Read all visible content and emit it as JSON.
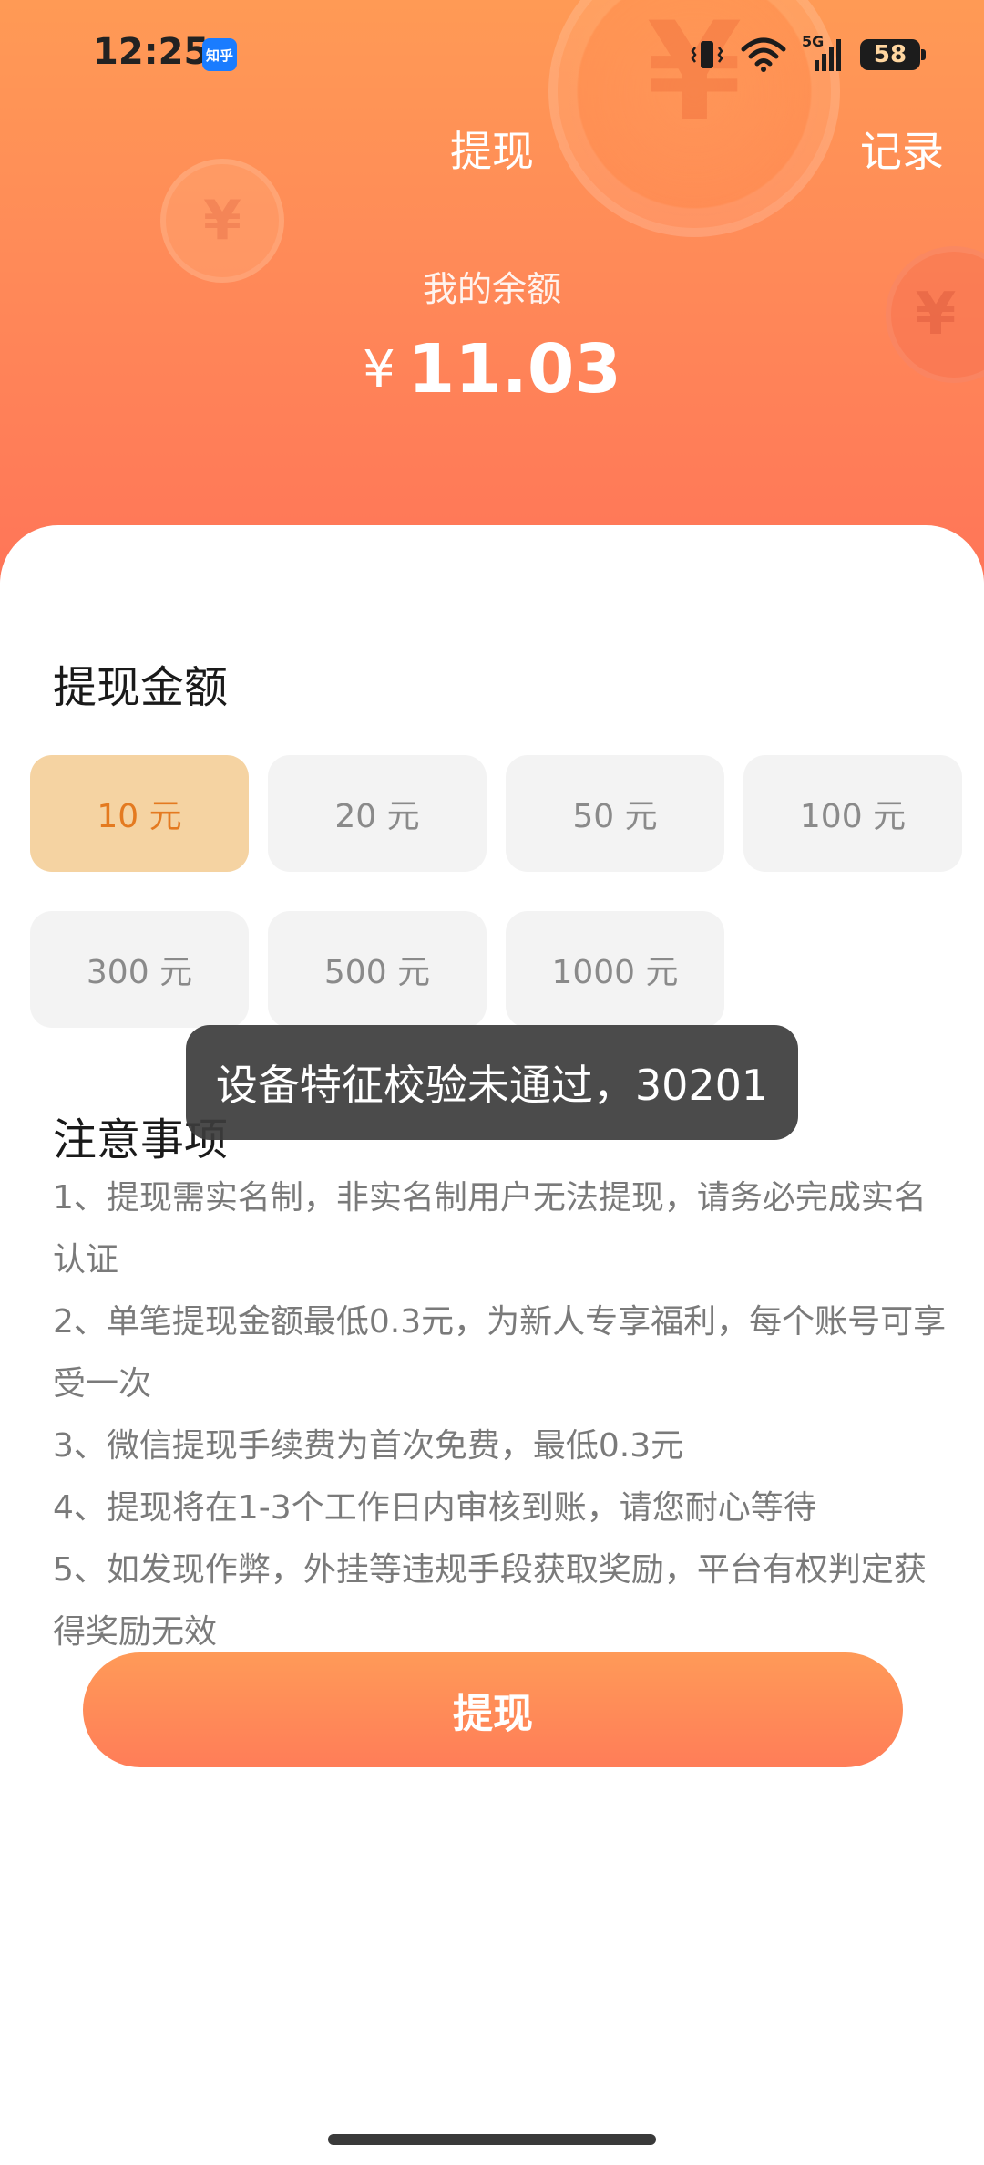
{
  "status_bar": {
    "time": "12:25",
    "app_badge": "知乎",
    "network_label": "5G",
    "battery": "58"
  },
  "nav": {
    "title": "提现",
    "record": "记录"
  },
  "balance": {
    "label": "我的余额",
    "currency": "¥",
    "amount": "11.03"
  },
  "amount_section": {
    "title": "提现金额",
    "options": [
      {
        "label": "10 元",
        "selected": true
      },
      {
        "label": "20 元",
        "selected": false
      },
      {
        "label": "50 元",
        "selected": false
      },
      {
        "label": "100 元",
        "selected": false
      },
      {
        "label": "300 元",
        "selected": false
      },
      {
        "label": "500 元",
        "selected": false
      },
      {
        "label": "1000 元",
        "selected": false
      }
    ]
  },
  "notice": {
    "title": "注意事项",
    "items": [
      "1、提现需实名制，非实名制用户无法提现，请务必完成实名认证",
      "2、单笔提现金额最低0.3元，为新人专享福利，每个账号可享受一次",
      "3、微信提现手续费为首次免费，最低0.3元",
      "4、提现将在1-3个工作日内审核到账，请您耐心等待",
      "5、如发现作弊，外挂等违规手段获取奖励，平台有权判定获得奖励无效"
    ]
  },
  "toast": "设备特征校验未通过，30201",
  "withdraw_button": "提现",
  "colors": {
    "header_top": "#ff9a55",
    "header_bottom": "#ff7558",
    "selected_bg": "#f5d3a2",
    "selected_text": "#e47a20",
    "button": "#ff8a58"
  },
  "decor": {
    "coin_symbol": "¥"
  }
}
